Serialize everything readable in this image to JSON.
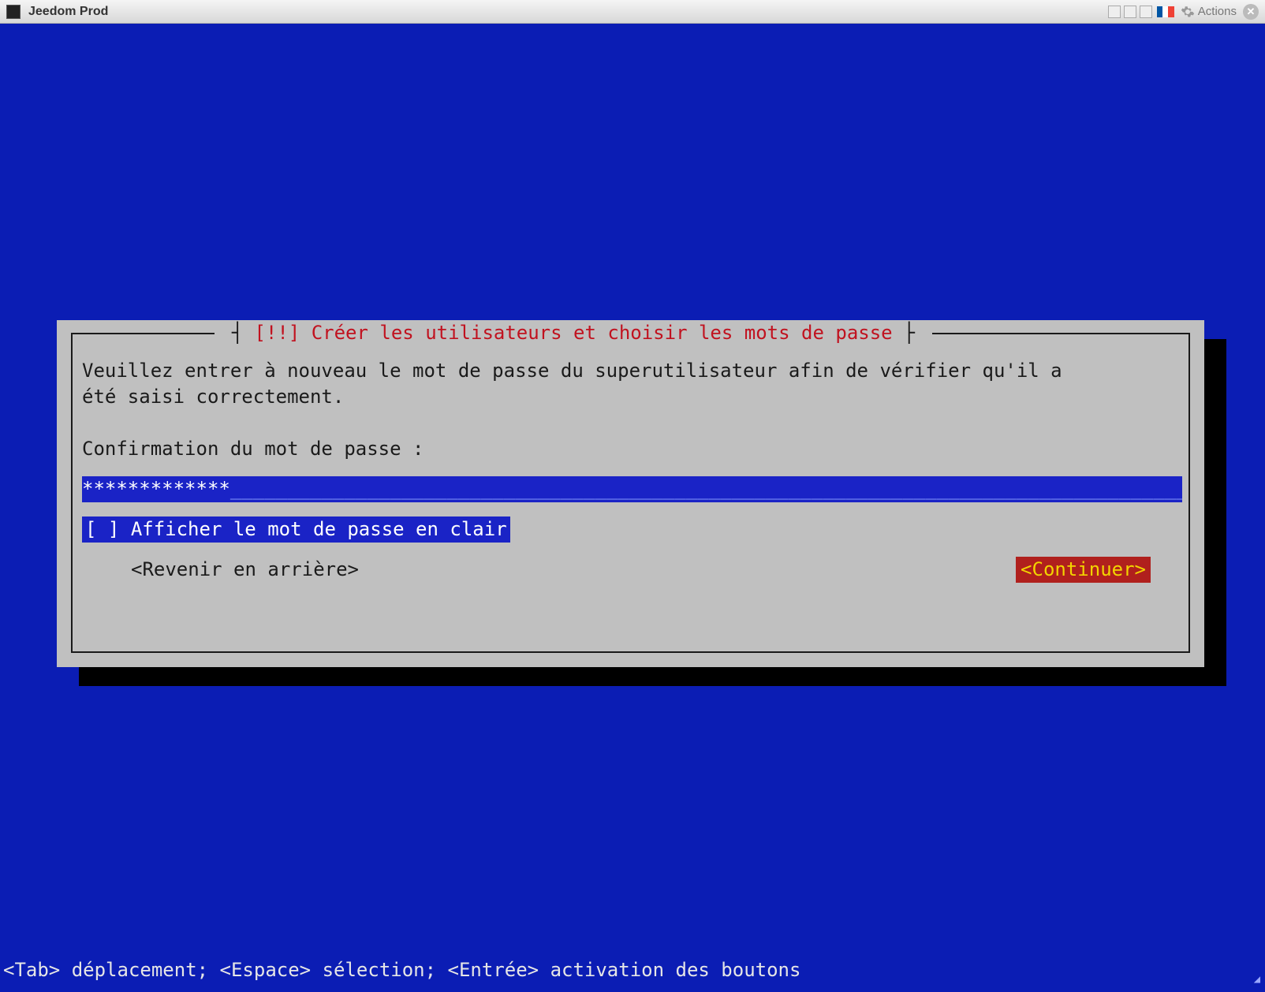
{
  "window": {
    "title": "Jeedom Prod",
    "actions_label": "Actions"
  },
  "installer": {
    "dialog_title": "[!!] Créer les utilisateurs et choisir les mots de passe",
    "body_line1": "Veuillez entrer à nouveau le mot de passe du superutilisateur afin de vérifier qu'il a",
    "body_line2": "été saisi correctement.",
    "prompt": "Confirmation du mot de passe :",
    "password_mask": "*************",
    "checkbox_state": "[ ]",
    "checkbox_label": "Afficher le mot de passe en clair",
    "go_back": "<Revenir en arrière>",
    "continue": "<Continuer>"
  },
  "hint": "<Tab> déplacement; <Espace> sélection; <Entrée> activation des boutons"
}
